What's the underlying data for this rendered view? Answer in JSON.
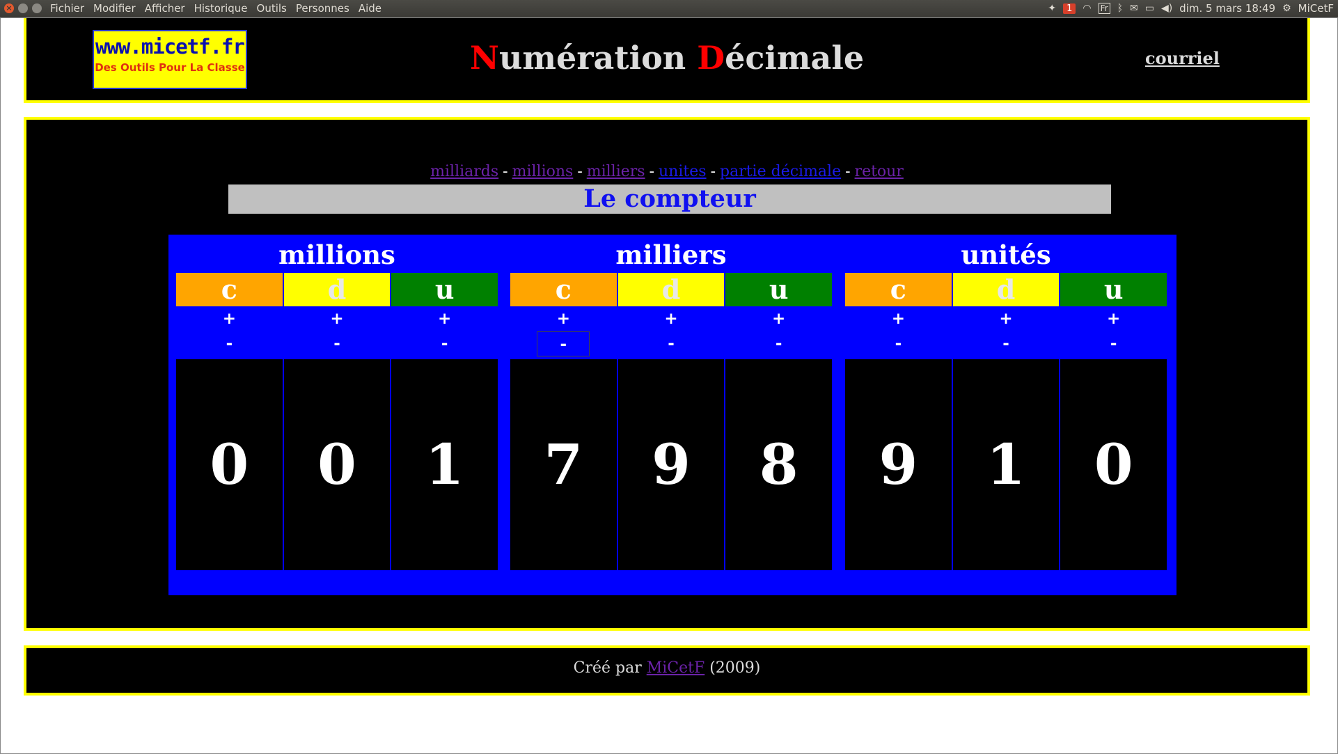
{
  "menubar": {
    "items": [
      "Fichier",
      "Modifier",
      "Afficher",
      "Historique",
      "Outils",
      "Personnes",
      "Aide"
    ],
    "notification_count": "1",
    "keyboard_layout": "Fr",
    "clock": "dim. 5 mars 18:49",
    "user": "MiCetF"
  },
  "header": {
    "logo_line1": "www.micetf.fr",
    "logo_line2": "Des Outils Pour La Classe",
    "title_cap1": "N",
    "title_rest1": "umération ",
    "title_cap2": "D",
    "title_rest2": "écimale",
    "courriel": "courriel"
  },
  "nav": {
    "links": [
      "milliards",
      "millions",
      "milliers",
      "unites",
      "partie décimale",
      "retour"
    ],
    "separator": "-"
  },
  "compteur_title": "Le compteur",
  "counter": {
    "groups": [
      {
        "title": "millions",
        "columns": [
          {
            "label": "c",
            "plus": "+",
            "minus": "-",
            "digit": "0"
          },
          {
            "label": "d",
            "plus": "+",
            "minus": "-",
            "digit": "0"
          },
          {
            "label": "u",
            "plus": "+",
            "minus": "-",
            "digit": "1"
          }
        ]
      },
      {
        "title": "milliers",
        "columns": [
          {
            "label": "c",
            "plus": "+",
            "minus": "-",
            "digit": "7"
          },
          {
            "label": "d",
            "plus": "+",
            "minus": "-",
            "digit": "9"
          },
          {
            "label": "u",
            "plus": "+",
            "minus": "-",
            "digit": "8"
          }
        ]
      },
      {
        "title": "unités",
        "columns": [
          {
            "label": "c",
            "plus": "+",
            "minus": "-",
            "digit": "9"
          },
          {
            "label": "d",
            "plus": "+",
            "minus": "-",
            "digit": "1"
          },
          {
            "label": "u",
            "plus": "+",
            "minus": "-",
            "digit": "0"
          }
        ]
      }
    ]
  },
  "footer": {
    "prefix": "Créé par ",
    "author": "MiCetF",
    "suffix": " (2009)"
  },
  "colors": {
    "panel_border": "#ffff00",
    "counter_bg": "#0000ff",
    "centaines": "#ffa500",
    "dizaines": "#ffff00",
    "unites": "#008000",
    "title_caps": "#ff0000"
  }
}
